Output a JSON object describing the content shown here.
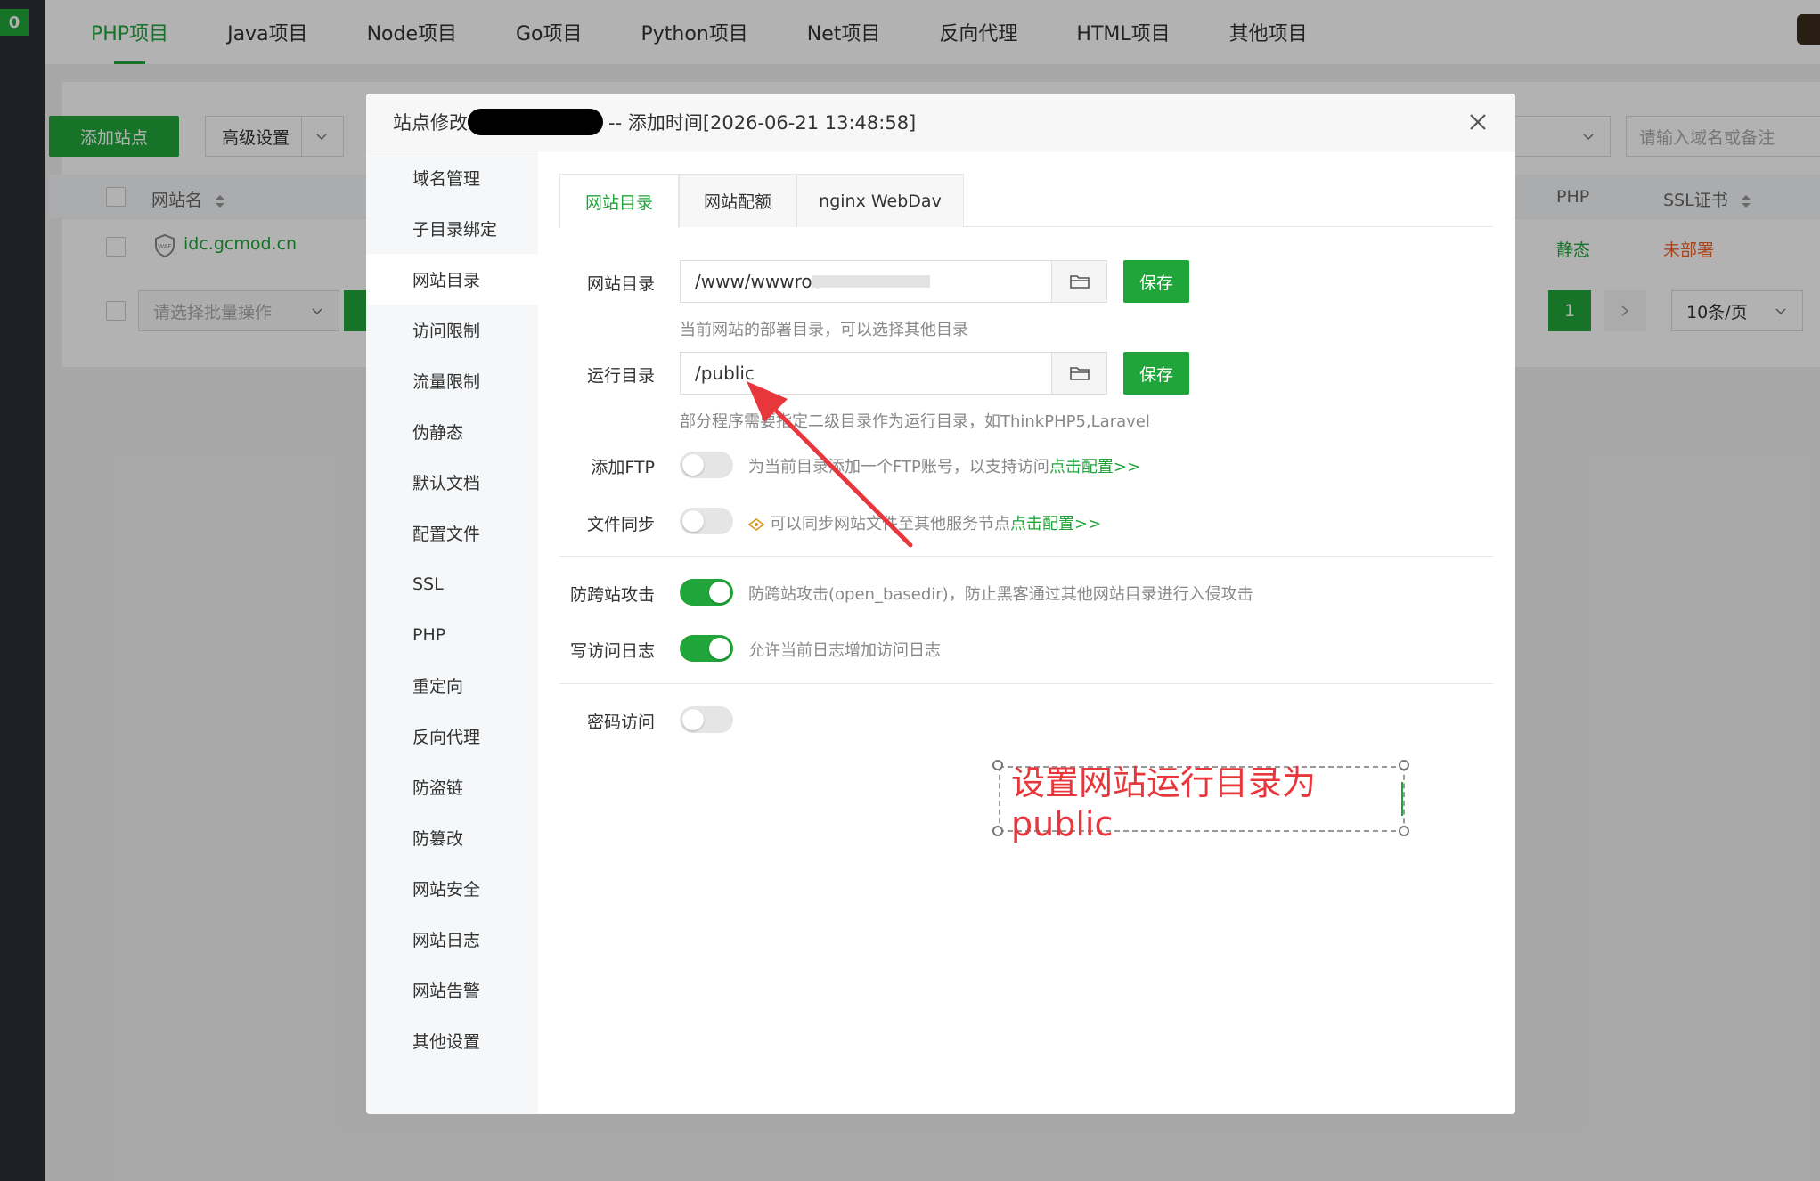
{
  "sidebar": {
    "badge": "0"
  },
  "top_tabs": [
    "PHP项目",
    "Java项目",
    "Node项目",
    "Go项目",
    "Python项目",
    "Net项目",
    "反向代理",
    "HTML项目",
    "其他项目"
  ],
  "toolbar": {
    "add_site": "添加站点",
    "advanced": "高级设置",
    "search_placeholder": "请输入域名或备注"
  },
  "table": {
    "col_site": "网站名",
    "col_php": "PHP",
    "col_ssl": "SSL证书",
    "row_site": "idc.gcmod.cn",
    "row_php": "静态",
    "row_ssl": "未部署",
    "waf_label": "WAF",
    "batch_placeholder": "请选择批量操作",
    "page_current": "1",
    "page_size": "10条/页"
  },
  "modal": {
    "title_prefix": "站点修改",
    "title_suffix": "-- 添加时间[2026-06-21 13:48:58]",
    "nav": [
      "域名管理",
      "子目录绑定",
      "网站目录",
      "访问限制",
      "流量限制",
      "伪静态",
      "默认文档",
      "配置文件",
      "SSL",
      "PHP",
      "重定向",
      "反向代理",
      "防盗链",
      "防篡改",
      "网站安全",
      "网站日志",
      "网站告警",
      "其他设置"
    ],
    "subtabs": [
      "网站目录",
      "网站配额",
      "nginx WebDav"
    ],
    "site_dir_label": "网站目录",
    "site_dir_value": "/www/wwwroo",
    "save": "保存",
    "site_dir_hint": "当前网站的部署目录，可以选择其他目录",
    "run_dir_label": "运行目录",
    "run_dir_value": "/public",
    "run_dir_hint": "部分程序需要指定二级目录作为运行目录，如ThinkPHP5,Laravel",
    "ftp_label": "添加FTP",
    "ftp_hint": "为当前目录添加一个FTP账号，以支持访问",
    "ftp_link": "点击配置>>",
    "sync_label": "文件同步",
    "sync_hint": "可以同步网站文件至其他服务节点",
    "sync_link": "点击配置>>",
    "anti_cross_label": "防跨站攻击",
    "anti_cross_hint": "防跨站攻击(open_basedir)，防止黑客通过其他网站目录进行入侵攻击",
    "access_log_label": "写访问日志",
    "access_log_hint": "允许当前日志增加访问日志",
    "password_label": "密码访问"
  },
  "toggles": {
    "ftp": false,
    "sync": false,
    "anti_cross": true,
    "access_log": true,
    "password": false
  },
  "annotation": {
    "text": "设置网站运行目录为public"
  },
  "colors": {
    "accent": "#20a53a",
    "danger": "#e8373c",
    "warning": "#f0632b"
  }
}
